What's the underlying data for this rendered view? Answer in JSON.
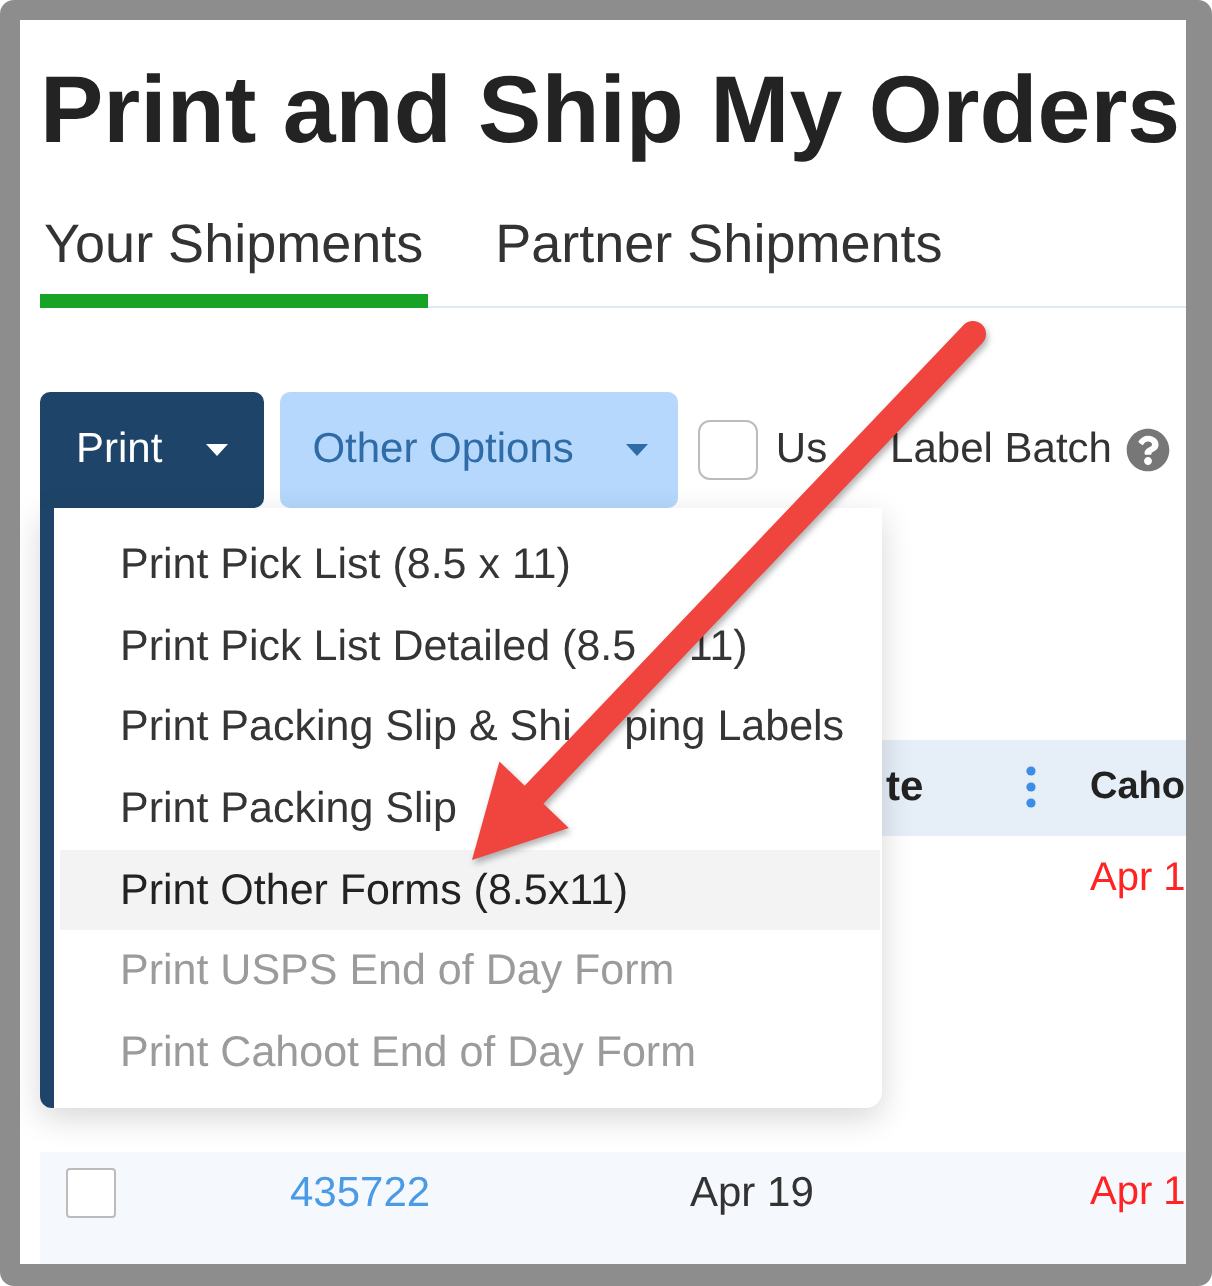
{
  "page": {
    "title": "Print and Ship My Orders"
  },
  "tabs": [
    {
      "label": "Your Shipments",
      "selected": true
    },
    {
      "label": "Partner Shipments",
      "selected": false
    }
  ],
  "toolbar": {
    "print_button": {
      "label": "Print",
      "expanded": true
    },
    "other_options_button": {
      "label": "Other Options"
    },
    "label_batch": {
      "label": "Us",
      "label_continued": "Label Batch",
      "checked": false
    }
  },
  "print_menu": {
    "items": [
      {
        "label": "Print Pick List (8.5 x 11)",
        "highlighted": false,
        "disabled": false
      },
      {
        "label": "Print Pick List Detailed (8.5",
        "label_continued": "11)",
        "highlighted": false,
        "disabled": false
      },
      {
        "label": "Print Packing Slip & Shi",
        "label_continued": "ping Labels",
        "highlighted": false,
        "disabled": false
      },
      {
        "label": "Print Packing Slip",
        "highlighted": false,
        "disabled": false
      },
      {
        "label": "Print Other Forms (8.5x11)",
        "highlighted": true,
        "disabled": false
      },
      {
        "label": "Print USPS End of Day Form",
        "highlighted": false,
        "disabled": true
      },
      {
        "label": "Print Cahoot End of Day Form",
        "highlighted": false,
        "disabled": true
      }
    ]
  },
  "table": {
    "header": {
      "column_3": "te",
      "column_4": "Caho"
    },
    "rows": [
      {
        "column_4": "Apr 1"
      },
      {
        "checked": false,
        "column_2": "435722",
        "column_3": "Apr 19",
        "column_4": "Apr 1"
      }
    ]
  }
}
